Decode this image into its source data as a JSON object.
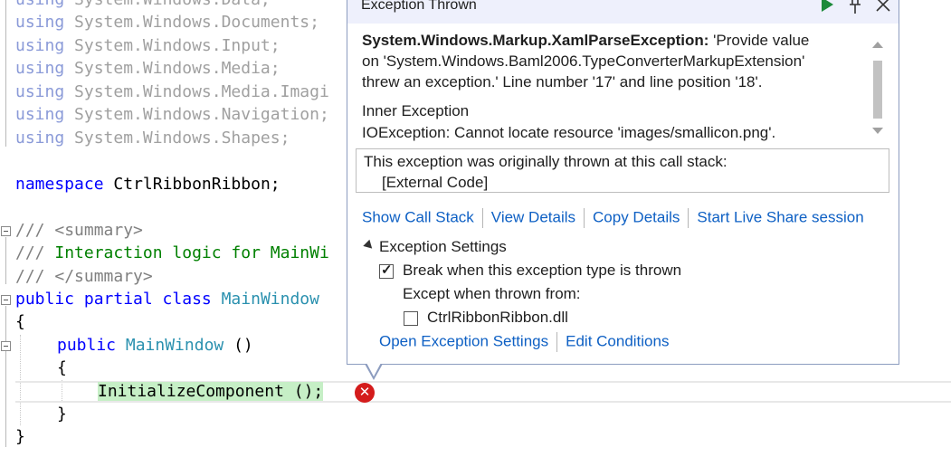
{
  "code": {
    "usings": [
      {
        "kw": "using",
        "ns": "System.Windows.Data;"
      },
      {
        "kw": "using",
        "ns": "System.Windows.Documents;"
      },
      {
        "kw": "using",
        "ns": "System.Windows.Input;"
      },
      {
        "kw": "using",
        "ns": "System.Windows.Media;"
      },
      {
        "kw": "using",
        "ns": "System.Windows.Media.Imagi"
      },
      {
        "kw": "using",
        "ns": "System.Windows.Navigation;"
      },
      {
        "kw": "using",
        "ns": "System.Windows.Shapes;"
      }
    ],
    "namespace_kw": "namespace",
    "namespace_name": "CtrlRibbonRibbon;",
    "summary_open_slashes": "///",
    "summary_open_tag": "<summary>",
    "summary_text_slashes": "///",
    "summary_text": "Interaction logic for MainWi",
    "summary_close_slashes": "///",
    "summary_close_tag": "</summary>",
    "class_kw": "public partial class",
    "class_name": "MainWindow",
    "open_brace": "{",
    "ctor_kw": "public",
    "ctor_name": "MainWindow",
    "ctor_parens": " ()",
    "ctor_open": "{",
    "init_call": "InitializeComponent ();",
    "ctor_close": "}",
    "class_close": "}"
  },
  "popup": {
    "title": "Exception Thrown",
    "exception_type": "System.Windows.Markup.XamlParseException:",
    "message_line1": " 'Provide value",
    "message_line2": "on 'System.Windows.Baml2006.TypeConverterMarkupExtension'",
    "message_line3": "threw an exception.' Line number '17' and line position '18'.",
    "inner_title": "Inner Exception",
    "inner_message": "IOException: Cannot locate resource 'images/smallicon.png'.",
    "stack_title": "This exception was originally thrown at this call stack:",
    "stack_frame": "[External Code]",
    "links": {
      "call_stack": "Show Call Stack",
      "view_details": "View Details",
      "copy_details": "Copy Details",
      "live_share": "Start Live Share session"
    },
    "settings": {
      "header": "Exception Settings",
      "break_label": "Break when this exception type is thrown",
      "break_checked": true,
      "except_label": "Except when thrown from:",
      "module_label": "CtrlRibbonRibbon.dll",
      "module_checked": false
    },
    "bottom_links": {
      "open_settings": "Open Exception Settings",
      "edit_conditions": "Edit Conditions"
    }
  },
  "icons": {
    "continue": "play-icon",
    "pin": "pin-icon",
    "close": "close-icon",
    "error": "error-icon"
  },
  "colors": {
    "keyword": "#0000ff",
    "type": "#2b91af",
    "comment": "#008000",
    "link": "#0e60c4",
    "error": "#d41c1c",
    "highlight": "#c6efc6"
  }
}
